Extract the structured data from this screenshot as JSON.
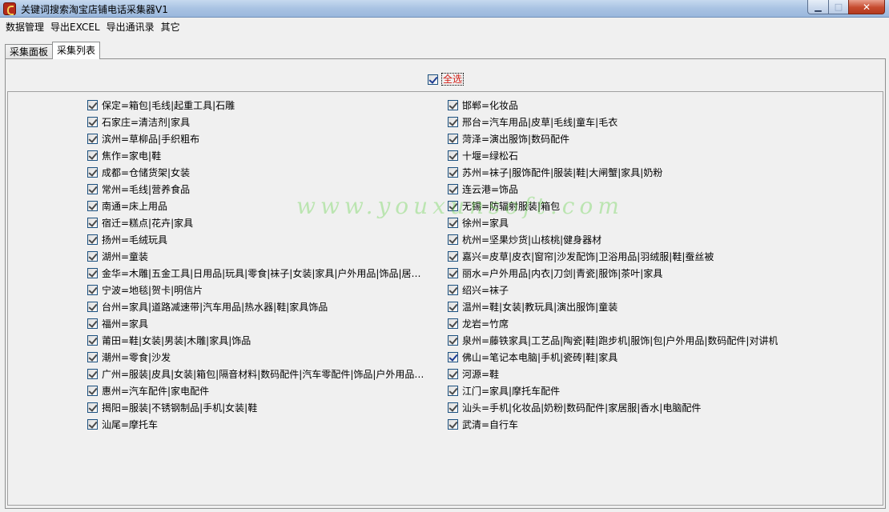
{
  "window": {
    "title": "关键词搜索淘宝店铺电话采集器V1",
    "minimize_glyph": "▁",
    "maximize_glyph": "□",
    "close_glyph": "✕"
  },
  "menu": [
    "数据管理",
    "导出EXCEL",
    "导出通讯录",
    "其它"
  ],
  "tabs": [
    "采集面板",
    "采集列表"
  ],
  "select_all": {
    "label": "全选",
    "checked": true
  },
  "left_list": [
    "保定=箱包|毛线|起重工具|石雕",
    "石家庄=清洁剂|家具",
    "滨州=草柳品|手织粗布",
    "焦作=家电|鞋",
    "成都=仓储货架|女装",
    "常州=毛线|营养食品",
    "南通=床上用品",
    "宿迁=糕点|花卉|家具",
    "扬州=毛绒玩具",
    "湖州=童装",
    "金华=木雕|五金工具|日用品|玩具|零食|袜子|女装|家具|户外用品|饰品|居…",
    "宁波=地毯|贺卡|明信片",
    "台州=家具|道路减速带|汽车用品|热水器|鞋|家具饰品",
    "福州=家具",
    "莆田=鞋|女装|男装|木雕|家具|饰品",
    "潮州=零食|沙发",
    "广州=服装|皮具|女装|箱包|隔音材料|数码配件|汽车零配件|饰品|户外用品…",
    "惠州=汽车配件|家电配件",
    "揭阳=服装|不锈钢制品|手机|女装|鞋",
    "汕尾=摩托车"
  ],
  "right_list": [
    "邯郸=化妆品",
    "邢台=汽车用品|皮草|毛线|童车|毛衣",
    "菏泽=演出服饰|数码配件",
    "十堰=绿松石",
    "苏州=袜子|服饰配件|服装|鞋|大闸蟹|家具|奶粉",
    "连云港=饰品",
    "无锡=防辐射服装|箱包",
    "徐州=家具",
    "杭州=坚果炒货|山核桃|健身器材",
    "嘉兴=皮草|皮衣|窗帘|沙发配饰|卫浴用品|羽绒服|鞋|蚕丝被",
    "丽水=户外用品|内衣|刀剑|青瓷|服饰|茶叶|家具",
    "绍兴=袜子",
    "温州=鞋|女装|教玩具|演出服饰|童装",
    "龙岩=竹席",
    "泉州=藤铁家具|工艺品|陶瓷|鞋|跑步机|服饰|包|户外用品|数码配件|对讲机",
    "佛山=笔记本电脑|手机|瓷砖|鞋|家具",
    "河源=鞋",
    "江门=家具|摩托车配件",
    "汕头=手机|化妆品|奶粉|数码配件|家居服|香水|电脑配件",
    "武清=自行车"
  ],
  "watermark": "www.youxunsoft.com"
}
